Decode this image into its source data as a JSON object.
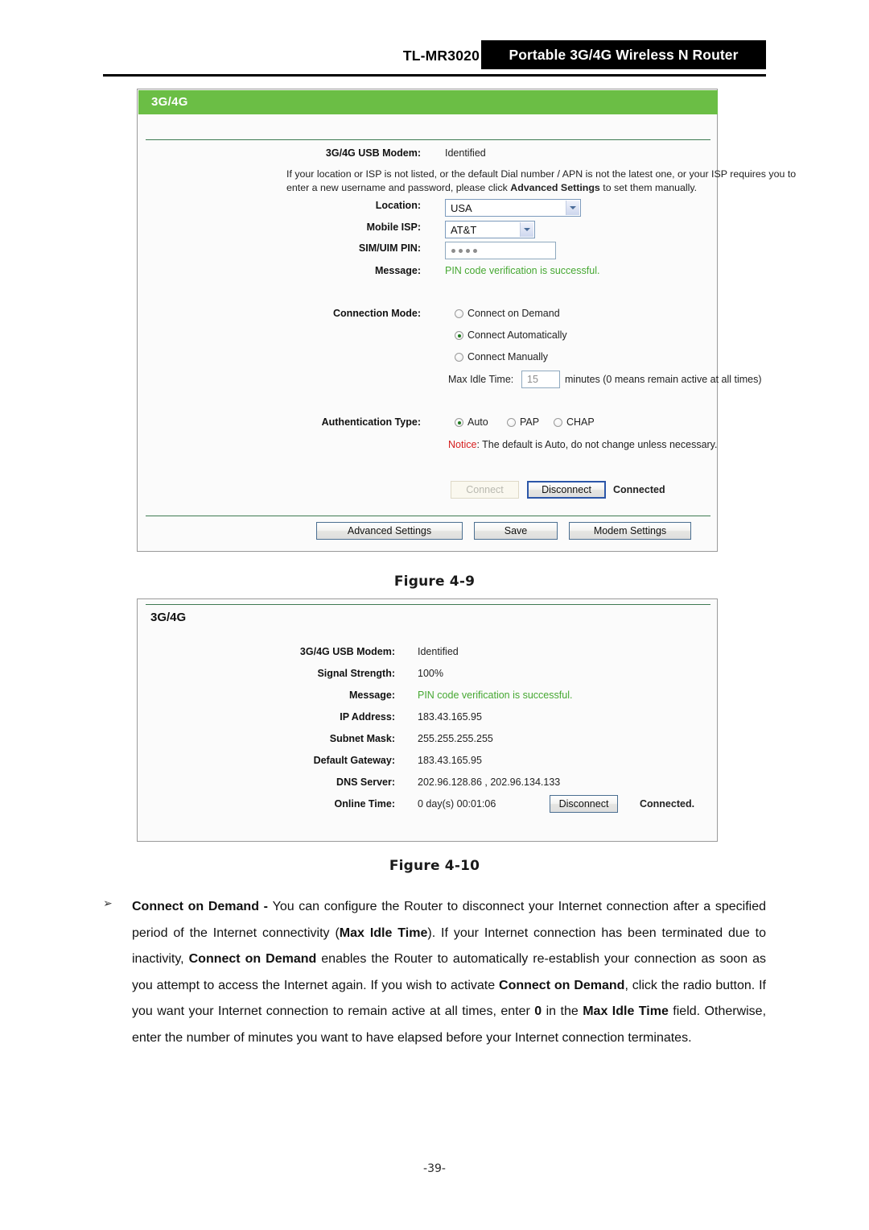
{
  "header": {
    "model": "TL-MR3020",
    "product": "Portable 3G/4G Wireless N Router"
  },
  "figure1": {
    "panel_title": "3G/4G",
    "modem_label": "3G/4G USB Modem:",
    "modem_value": "Identified",
    "help_text_1": "If your location or ISP is not listed, or the default Dial number / APN is not the latest one, or your ISP requires you to",
    "help_text_2a": "enter a new username and password, please click ",
    "help_text_2b": "Advanced Settings",
    "help_text_2c": " to set them manually.",
    "location_label": "Location:",
    "location_value": "USA",
    "isp_label": "Mobile ISP:",
    "isp_value": "AT&T",
    "pin_label": "SIM/UIM PIN:",
    "pin_value": "••••",
    "message_label": "Message:",
    "message_value": "PIN code verification is successful.",
    "conn_mode_label": "Connection Mode:",
    "mode_on_demand": "Connect on Demand",
    "mode_automatically": "Connect Automatically",
    "mode_manually": "Connect Manually",
    "max_idle_label": "Max Idle Time:",
    "max_idle_value": "15",
    "max_idle_suffix": "minutes (0 means remain active at all times)",
    "auth_label": "Authentication Type:",
    "auth_auto": "Auto",
    "auth_pap": "PAP",
    "auth_chap": "CHAP",
    "notice_word": "Notice",
    "notice_rest": ": The default is Auto, do not change unless necessary.",
    "connect_button": "Connect",
    "disconnect_button": "Disconnect",
    "status_text": "Connected",
    "advanced_settings_button": "Advanced Settings",
    "save_button": "Save",
    "modem_settings_button": "Modem Settings",
    "caption": "Figure 4-9"
  },
  "figure2": {
    "panel_title": "3G/4G",
    "rows": [
      {
        "label": "3G/4G USB Modem:",
        "value": "Identified",
        "green": false
      },
      {
        "label": "Signal Strength:",
        "value": "100%",
        "green": false
      },
      {
        "label": "Message:",
        "value": "PIN code verification is successful.",
        "green": true
      },
      {
        "label": "IP Address:",
        "value": "183.43.165.95",
        "green": false
      },
      {
        "label": "Subnet Mask:",
        "value": "255.255.255.255",
        "green": false
      },
      {
        "label": "Default Gateway:",
        "value": "183.43.165.95",
        "green": false
      },
      {
        "label": "DNS Server:",
        "value": "202.96.128.86 , 202.96.134.133",
        "green": false
      },
      {
        "label": "Online Time:",
        "value": "0 day(s) 00:01:06",
        "green": false
      }
    ],
    "disconnect_button": "Disconnect",
    "status_text": "Connected.",
    "caption": "Figure 4-10"
  },
  "body": {
    "bullet_marker": "➢",
    "term": "Connect on Demand",
    "dash": " - ",
    "text_1": "You can configure the Router to disconnect your Internet connection after a specified period of the Internet connectivity (",
    "bold_2": "Max Idle Time",
    "text_3": "). If your Internet connection has been terminated due to inactivity, ",
    "bold_4": "Connect on Demand",
    "text_5": " enables the Router to automatically re-establish your connection as soon as you attempt to access the Internet again. If you wish to activate ",
    "bold_6": "Connect on Demand",
    "text_7": ", click the radio button. If you want your Internet connection to remain active at all times, enter ",
    "bold_8": "0",
    "text_9": " in the ",
    "bold_10": "Max Idle Time",
    "text_11": " field. Otherwise, enter the number of minutes you want to have elapsed before your Internet connection terminates."
  },
  "footer": {
    "page_number": "-39-"
  },
  "colors": {
    "green_header": "#6bbe45",
    "green_text": "#46a832",
    "notice_red": "#d61f1f",
    "button_border": "#4b6f91"
  }
}
